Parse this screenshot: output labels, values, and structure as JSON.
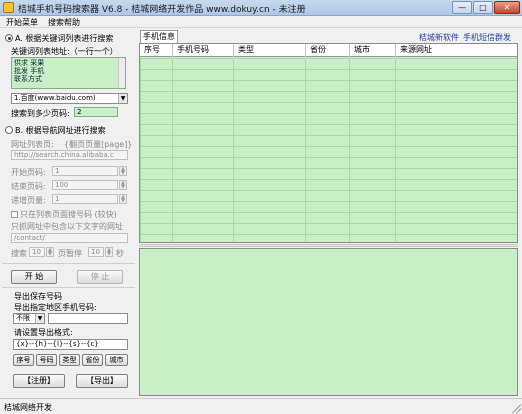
{
  "window": {
    "title": "桔城手机号码搜索器 V6.8 - 桔城网络开发作品 www.dokuy.cn  - 未注册",
    "min_label": "—",
    "max_label": "□",
    "close_label": "✕"
  },
  "menu": {
    "items": [
      "开始菜单",
      "搜索帮助"
    ]
  },
  "mode_keyword": {
    "label": "A. 根据关键词列表进行搜索",
    "list_label": "关键词列表地址:（一行一个）",
    "keywords": [
      "供求 采果",
      "批发 手机",
      "联系方式"
    ],
    "engine_selected": "1.百度(www.baidu.com)",
    "pages_label": "搜索到多少页码:",
    "pages_value": "2"
  },
  "mode_url": {
    "label": "B. 根据导航网址进行搜索",
    "list_label": "网址列表页:",
    "list_hint": "{翻页页量[page]}",
    "url_value": "http://search.china.alibaba.c",
    "start_label": "开始页码:",
    "start_value": "1",
    "end_label": "结束页码:",
    "end_value": "100",
    "step_label": "递增页量:",
    "step_value": "1",
    "only_list_label": "只在列表页面搜号码 (较快)",
    "contain_label": "只抓网址中包含以下文字的网址",
    "contain_value": "/contact/",
    "search_label": "搜索",
    "search_value": "10",
    "pause_label": "页暂停",
    "pause_value": "10",
    "seconds_label": "秒"
  },
  "actions": {
    "start": "开 始",
    "stop": "停 止"
  },
  "export": {
    "section_label": "导出保存号码",
    "region_label": "导出指定地区手机号码:",
    "region_selected": "不限",
    "format_label": "请设置导出格式:",
    "format_value": "{x}--{h}--{l}--{s}--{c}",
    "field_buttons": [
      "序号",
      "号码",
      "类型",
      "省份",
      "城市"
    ],
    "register": "【注册】",
    "export": "【导出】"
  },
  "tab": {
    "label": "手机信息"
  },
  "links": {
    "software": "桔城新软件",
    "sms": "手机短信群发"
  },
  "grid": {
    "columns": [
      "序号",
      "手机号码",
      "类型",
      "省份",
      "城市",
      "来源网址"
    ]
  },
  "status": {
    "text": "桔城网络开发"
  }
}
